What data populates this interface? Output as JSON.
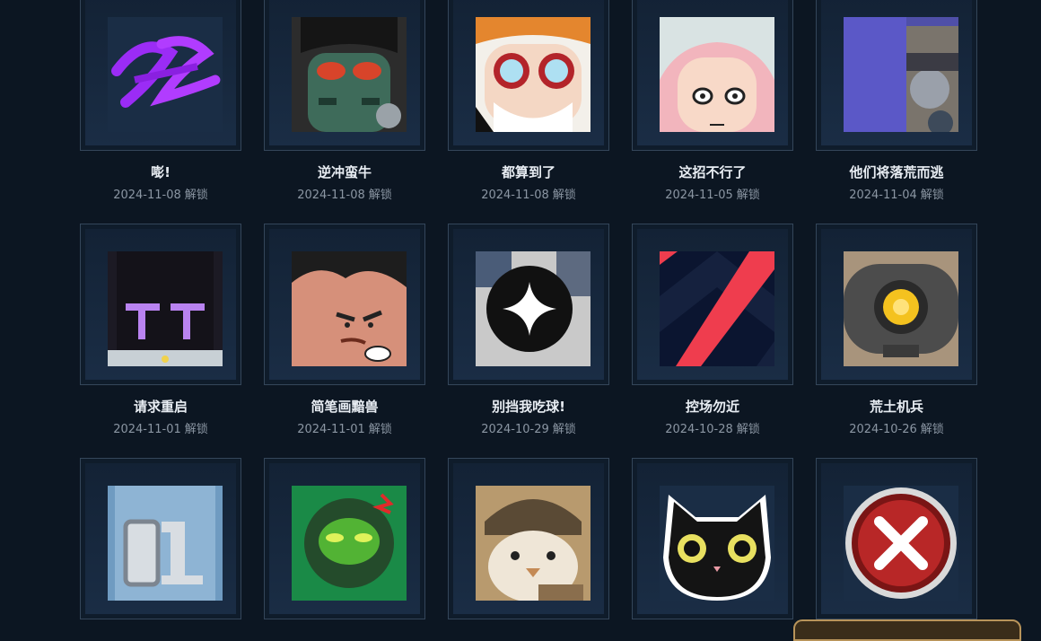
{
  "unlock_label": "解锁",
  "rows": [
    [
      {
        "name": "嘭!",
        "date": "2024-11-08",
        "icon": "purple-graffiti-icon"
      },
      {
        "name": "逆冲蛮牛",
        "date": "2024-11-08",
        "icon": "masked-robot-icon"
      },
      {
        "name": "都算到了",
        "date": "2024-11-08",
        "icon": "goggles-old-man-icon"
      },
      {
        "name": "这招不行了",
        "date": "2024-11-05",
        "icon": "worried-girl-icon"
      },
      {
        "name": "他们将落荒而逃",
        "date": "2024-11-04",
        "icon": "armored-arm-icon"
      }
    ],
    [
      {
        "name": "请求重启",
        "date": "2024-11-01",
        "icon": "robot-face-icon"
      },
      {
        "name": "简笔画黯兽",
        "date": "2024-11-01",
        "icon": "angry-face-icon"
      },
      {
        "name": "别挡我吃球!",
        "date": "2024-10-29",
        "icon": "black-orb-icon"
      },
      {
        "name": "控场勿近",
        "date": "2024-10-28",
        "icon": "chevron-logo-icon"
      },
      {
        "name": "荒土机兵",
        "date": "2024-10-26",
        "icon": "yellow-eye-robot-icon"
      }
    ],
    [
      {
        "name": "",
        "date": "",
        "icon": "number-01-icon"
      },
      {
        "name": "",
        "date": "",
        "icon": "green-soldier-icon"
      },
      {
        "name": "",
        "date": "",
        "icon": "penguin-beanie-icon"
      },
      {
        "name": "",
        "date": "",
        "icon": "black-cat-icon"
      },
      {
        "name": "",
        "date": "",
        "icon": "red-x-icon"
      }
    ]
  ]
}
